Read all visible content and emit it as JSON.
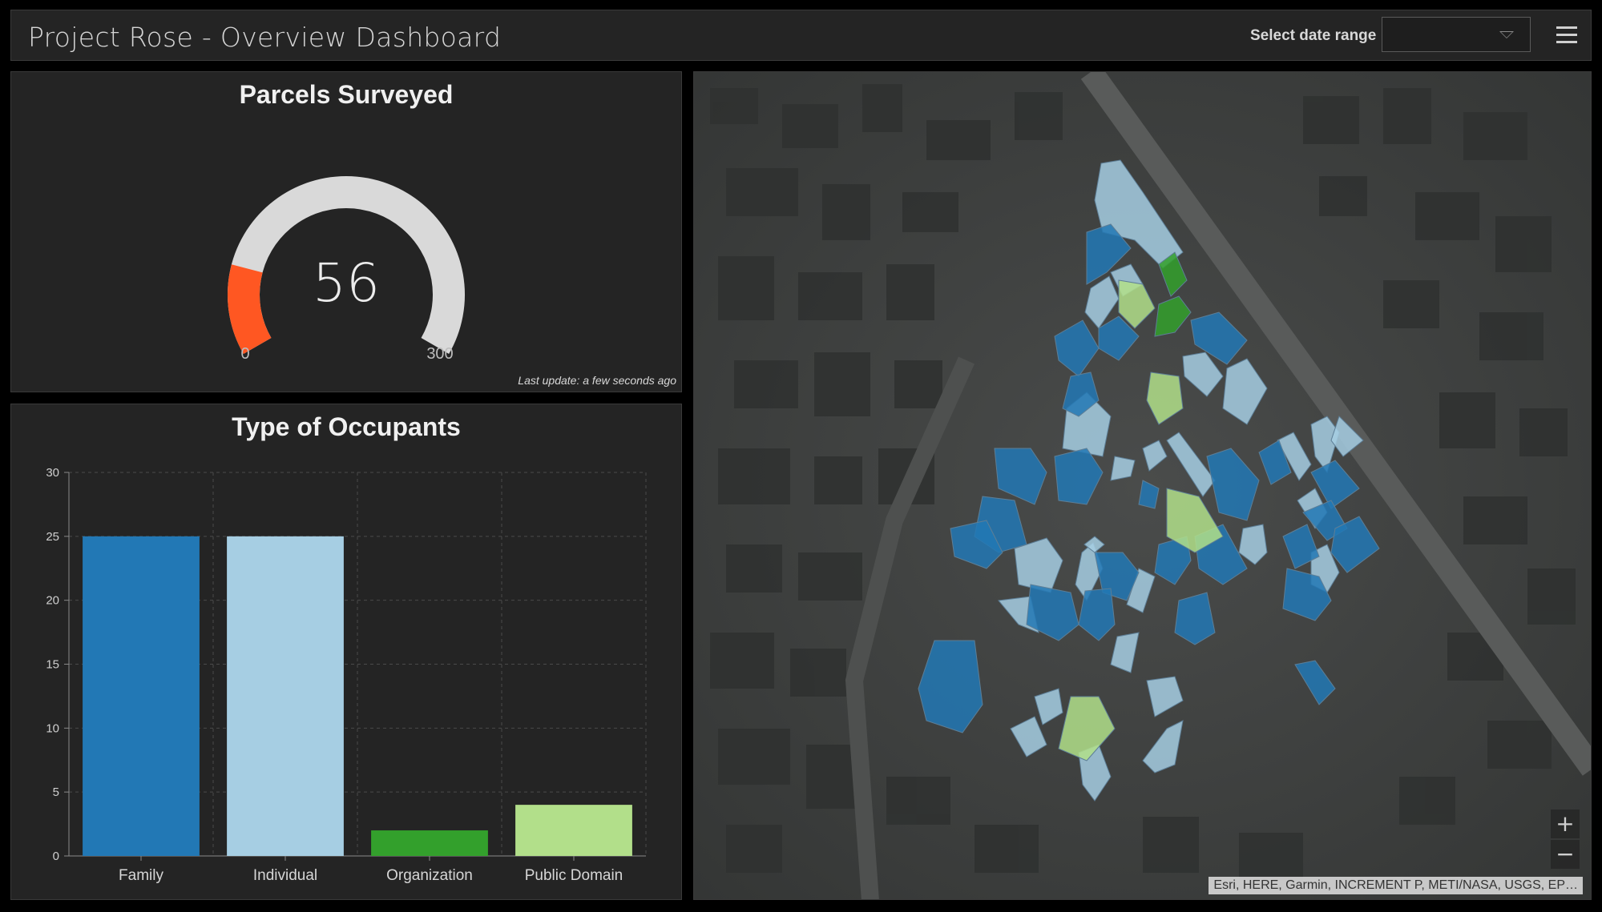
{
  "header": {
    "title": "Project Rose - Overview Dashboard",
    "date_range_label": "Select date range",
    "date_range_value": "",
    "menu_icon": "hamburger-menu-icon"
  },
  "gauge": {
    "title": "Parcels Surveyed",
    "value": 56,
    "value_text": "56",
    "min": 0,
    "max": 300,
    "min_label": "0",
    "max_label": "300",
    "last_update": "Last update: a few seconds ago",
    "fill_color": "#ff5722",
    "track_color": "#d9d9d9"
  },
  "chart_data": {
    "type": "bar",
    "title": "Type of Occupants",
    "categories": [
      "Family",
      "Individual",
      "Organization",
      "Public Domain"
    ],
    "values": [
      25,
      25,
      2,
      4
    ],
    "colors": [
      "#2278b5",
      "#a6cee3",
      "#33a02c",
      "#b2df8a"
    ],
    "ylim": [
      0,
      30
    ],
    "yticks": [
      0,
      5,
      10,
      15,
      20,
      25,
      30
    ],
    "xlabel": "",
    "ylabel": "",
    "grid": true
  },
  "map": {
    "zoom_in_label": "+",
    "zoom_out_label": "−",
    "attribution": "Esri, HERE, Garmin, INCREMENT P, METI/NASA, USGS, EP…",
    "parcel_colors": {
      "Family": "#2278b5",
      "Individual": "#a6cee3",
      "Organization": "#33a02c",
      "Public Domain": "#b2df8a"
    }
  }
}
